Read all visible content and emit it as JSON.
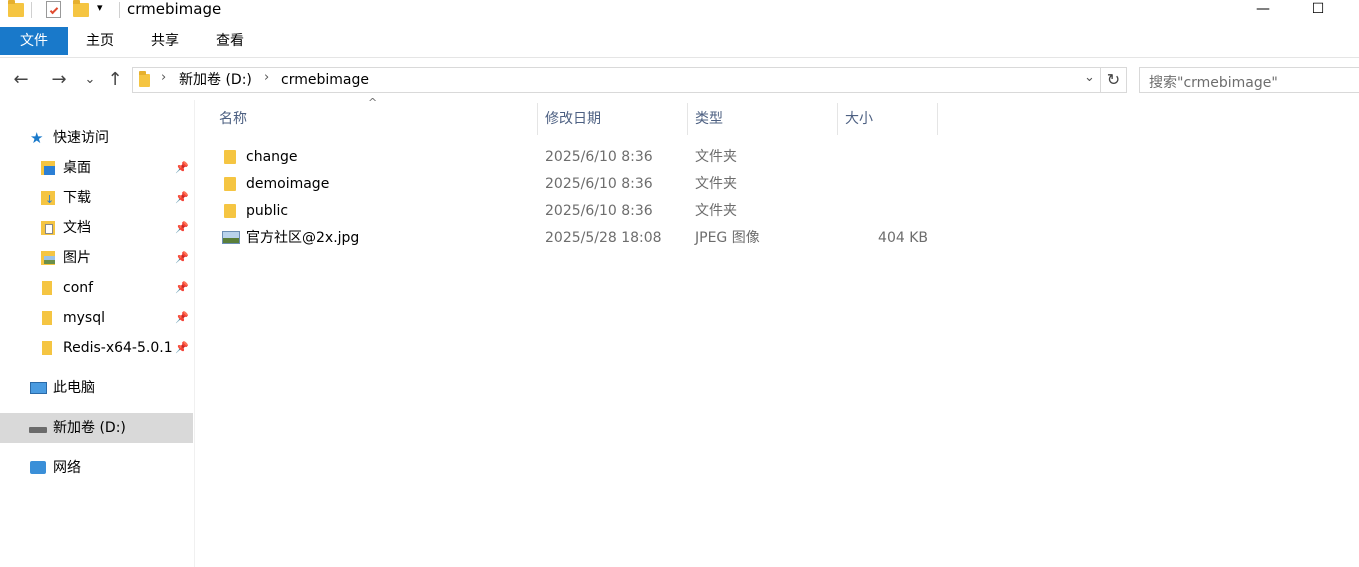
{
  "titlebar": {
    "title": "crmebimage",
    "dropdown_glyph": "▾",
    "minimize_glyph": "—",
    "maximize_glyph": "☐"
  },
  "ribbon": {
    "tabs": [
      "文件",
      "主页",
      "共享",
      "查看"
    ]
  },
  "nav": {
    "back_glyph": "←",
    "forward_glyph": "→",
    "recent_glyph": "⌄",
    "up_glyph": "↑"
  },
  "address": {
    "crumbs": [
      "新加卷 (D:)",
      "crmebimage"
    ],
    "separator": "›",
    "dropdown_glyph": "⌄",
    "refresh_glyph": "↻"
  },
  "search": {
    "placeholder": "搜索\"crmebimage\""
  },
  "sidebar": {
    "quick_access": "快速访问",
    "items": [
      {
        "label": "桌面",
        "icon": "desktop-icon",
        "pinned": true
      },
      {
        "label": "下载",
        "icon": "downloads-icon",
        "pinned": true
      },
      {
        "label": "文档",
        "icon": "documents-icon",
        "pinned": true
      },
      {
        "label": "图片",
        "icon": "pictures-icon",
        "pinned": true
      },
      {
        "label": "conf",
        "icon": "folder-icon",
        "pinned": true
      },
      {
        "label": "mysql",
        "icon": "folder-icon",
        "pinned": true
      },
      {
        "label": "Redis-x64-5.0.1",
        "icon": "folder-icon",
        "pinned": true
      }
    ],
    "this_pc": "此电脑",
    "drive": "新加卷 (D:)",
    "network": "网络",
    "pin_glyph": "📌"
  },
  "columns": {
    "name": "名称",
    "date": "修改日期",
    "type": "类型",
    "size": "大小",
    "sort_glyph": "^"
  },
  "files": [
    {
      "name": "change",
      "date": "2025/6/10 8:36",
      "type": "文件夹",
      "size": "",
      "icon": "folder-icon"
    },
    {
      "name": "demoimage",
      "date": "2025/6/10 8:36",
      "type": "文件夹",
      "size": "",
      "icon": "folder-icon"
    },
    {
      "name": "public",
      "date": "2025/6/10 8:36",
      "type": "文件夹",
      "size": "",
      "icon": "folder-icon"
    },
    {
      "name": "官方社区@2x.jpg",
      "date": "2025/5/28 18:08",
      "type": "JPEG 图像",
      "size": "404 KB",
      "icon": "image-file-icon"
    }
  ],
  "colors": {
    "accent": "#1979ca",
    "folder": "#f5c542",
    "selected_bg": "#d9d9d9"
  }
}
